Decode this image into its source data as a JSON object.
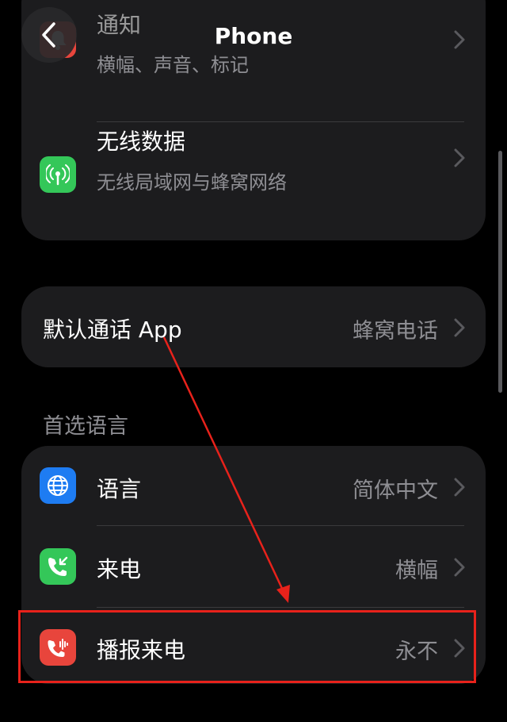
{
  "nav": {
    "title": "Phone",
    "back": "back"
  },
  "group1": [
    {
      "title": "通知",
      "subtitle": "横幅、声音、标记",
      "icon": "bell-icon",
      "icon_color": "#e8453c"
    },
    {
      "title": "无线数据",
      "subtitle": "无线局域网与蜂窝网络",
      "icon": "wireless-antenna-icon",
      "icon_color": "#34c759"
    }
  ],
  "default_app": {
    "title": "默认通话 App",
    "value": "蜂窝电话"
  },
  "section_header": "首选语言",
  "group2": [
    {
      "title": "语言",
      "value": "简体中文",
      "icon": "globe-icon",
      "icon_color": "#1e7cf2"
    },
    {
      "title": "来电",
      "value": "横幅",
      "icon": "incoming-call-icon",
      "icon_color": "#34c759"
    },
    {
      "title": "播报来电",
      "value": "永不",
      "icon": "announce-call-icon",
      "icon_color": "#e8453c"
    }
  ],
  "colors": {
    "background": "#000000",
    "card": "#1c1c1e",
    "annotation": "#e8221b"
  }
}
